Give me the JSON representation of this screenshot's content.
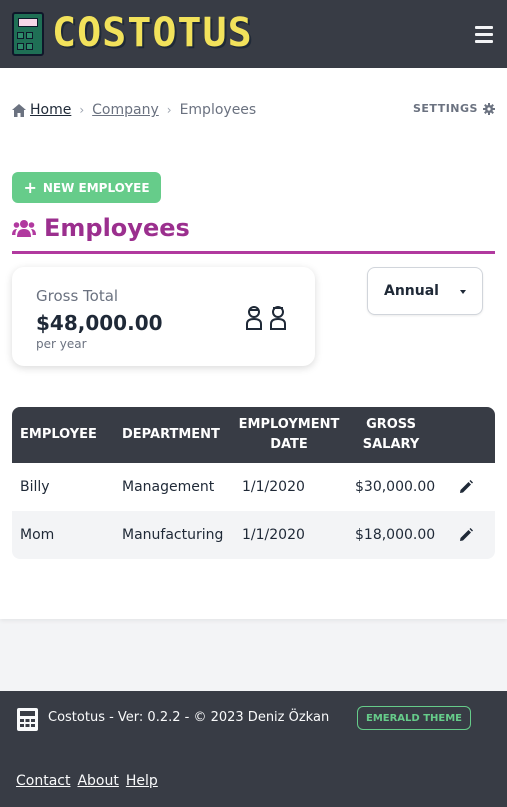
{
  "header": {
    "logo_text": "COSTOTUS",
    "menu_icon": "hamburger-menu-icon"
  },
  "breadcrumb": {
    "home": "Home",
    "company": "Company",
    "current": "Employees"
  },
  "settings_label": "SETTINGS",
  "new_employee_label": "NEW EMPLOYEE",
  "page_title": "Employees",
  "summary": {
    "label": "Gross Total",
    "value": "$48,000.00",
    "sub": "per year"
  },
  "period_select": {
    "selected": "Annual"
  },
  "table": {
    "columns": [
      "EMPLOYEE",
      "DEPARTMENT",
      "EMPLOYMENT DATE",
      "GROSS SALARY"
    ],
    "rows": [
      {
        "employee": "Billy",
        "department": "Management",
        "date": "1/1/2020",
        "salary": "$30,000.00"
      },
      {
        "employee": "Mom",
        "department": "Manufacturing",
        "date": "1/1/2020",
        "salary": "$18,000.00"
      }
    ]
  },
  "footer": {
    "credit": "Costotus - Ver: 0.2.2 - © 2023 Deniz Özkan",
    "theme_badge": "EMERALD THEME",
    "links": [
      "Contact",
      "About",
      "Help"
    ]
  },
  "colors": {
    "header_bg": "#383c45",
    "accent_green": "#66cc8a",
    "title_purple": "#9b2f8e",
    "logo_yellow": "#f2e25b"
  }
}
